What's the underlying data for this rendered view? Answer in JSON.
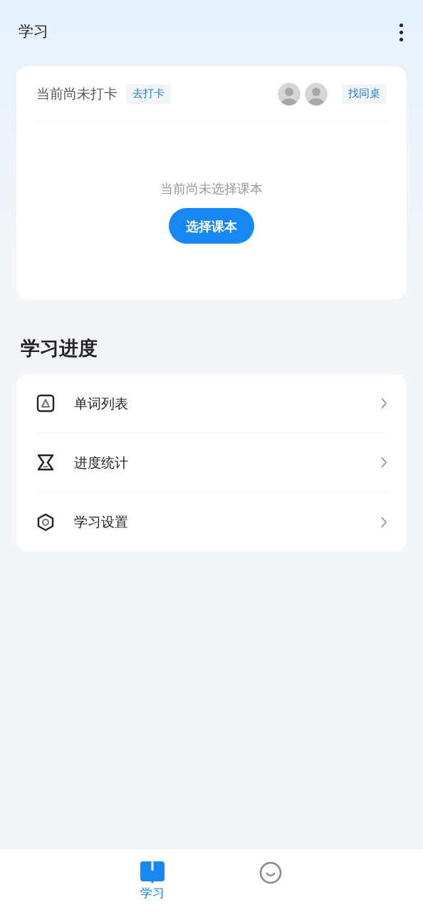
{
  "header": {
    "title": "学习"
  },
  "checkin_card": {
    "status": "当前尚未打卡",
    "checkin_button": "去打卡",
    "avatars": [
      {
        "kind": "placeholder"
      },
      {
        "kind": "placeholder"
      }
    ],
    "deskmate_button": "找同桌",
    "empty_message": "当前尚未选择课本",
    "choose_button": "选择课本"
  },
  "section_title": "学习进度",
  "menu": [
    {
      "kind": "words",
      "label": "单词列表"
    },
    {
      "kind": "stats",
      "label": "进度统计"
    },
    {
      "kind": "settings",
      "label": "学习设置"
    }
  ],
  "tabs": [
    {
      "kind": "book",
      "label": "学习",
      "selected": true
    },
    {
      "kind": "smile",
      "selected": false
    }
  ]
}
